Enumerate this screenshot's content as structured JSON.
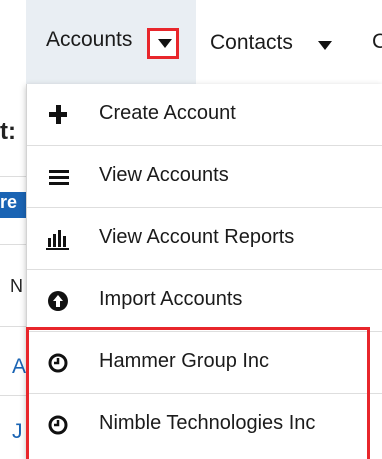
{
  "navbar": {
    "accounts_label": "Accounts",
    "contacts_label": "Contacts",
    "next_label": "C"
  },
  "background": {
    "frag_t": "t:",
    "frag_re": "re",
    "frag_n": "N",
    "frag_a": "A",
    "frag_j": "J"
  },
  "dropdown": {
    "items": [
      {
        "label": "Create Account",
        "icon": "plus-icon"
      },
      {
        "label": "View Accounts",
        "icon": "list-icon"
      },
      {
        "label": "View Account Reports",
        "icon": "bar-chart-icon"
      },
      {
        "label": "Import Accounts",
        "icon": "upload-icon"
      },
      {
        "label": "Hammer Group Inc",
        "icon": "clock-icon"
      },
      {
        "label": "Nimble Technologies Inc",
        "icon": "clock-icon"
      }
    ]
  },
  "colors": {
    "highlight": "#e8262b",
    "nav_active_bg": "#e9eef3",
    "link_blue": "#1a64b4"
  }
}
